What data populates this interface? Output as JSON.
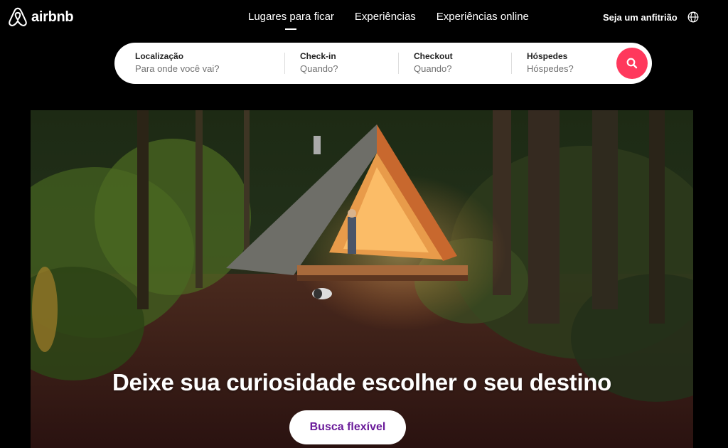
{
  "brand": {
    "name": "airbnb",
    "color": "#ff385c"
  },
  "nav": {
    "items": [
      "Lugares para ficar",
      "Experiências",
      "Experiências online"
    ],
    "active_index": 0
  },
  "header": {
    "host_link": "Seja um anfitrião",
    "language_icon": "globe-icon"
  },
  "search": {
    "location": {
      "label": "Localização",
      "placeholder": "Para onde você vai?"
    },
    "checkin": {
      "label": "Check-in",
      "placeholder": "Quando?"
    },
    "checkout": {
      "label": "Checkout",
      "placeholder": "Quando?"
    },
    "guests": {
      "label": "Hóspedes",
      "placeholder": "Hóspedes?"
    },
    "button_icon": "search-icon"
  },
  "hero": {
    "headline": "Deixe sua curiosidade escolher o seu destino",
    "button_label": "Busca flexível",
    "button_color": "#6a1b9a"
  }
}
